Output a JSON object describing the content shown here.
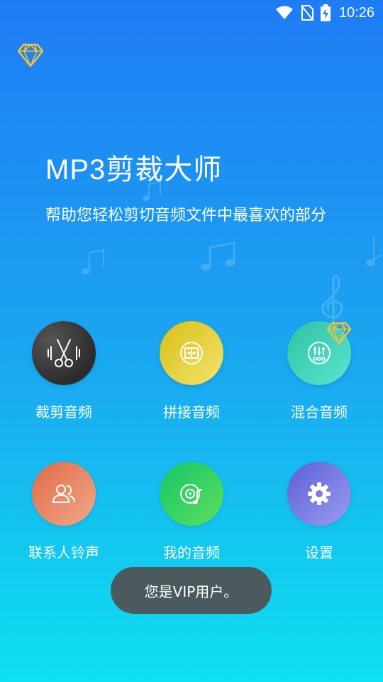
{
  "status_bar": {
    "time": "10:26",
    "icons": [
      "wifi-icon",
      "no-sim-icon",
      "battery-charging-icon"
    ]
  },
  "header": {
    "vip_icon": "diamond-icon"
  },
  "hero": {
    "title": "MP3剪裁大师",
    "subtitle": "帮助您轻松剪切音频文件中最喜欢的部分"
  },
  "features": [
    {
      "label": "裁剪音频",
      "icon": "scissors-waveform-icon",
      "color": "#2c2c2c"
    },
    {
      "label": "拼接音频",
      "icon": "merge-icon",
      "color": "#e2cb2a"
    },
    {
      "label": "混合音频",
      "icon": "mixer-icon",
      "color": "#3fd3b9",
      "vip": true
    },
    {
      "label": "联系人铃声",
      "icon": "contacts-icon",
      "color": "#e9865f"
    },
    {
      "label": "我的音频",
      "icon": "music-disc-icon",
      "color": "#2fd160"
    },
    {
      "label": "设置",
      "icon": "gear-icon",
      "color": "#7a7ee3"
    }
  ],
  "toast": {
    "message": "您是VIP用户。"
  },
  "colors": {
    "accent_gold": "#f4c430",
    "background_top": "#1f7cf5",
    "background_bottom": "#0ee0f0"
  }
}
